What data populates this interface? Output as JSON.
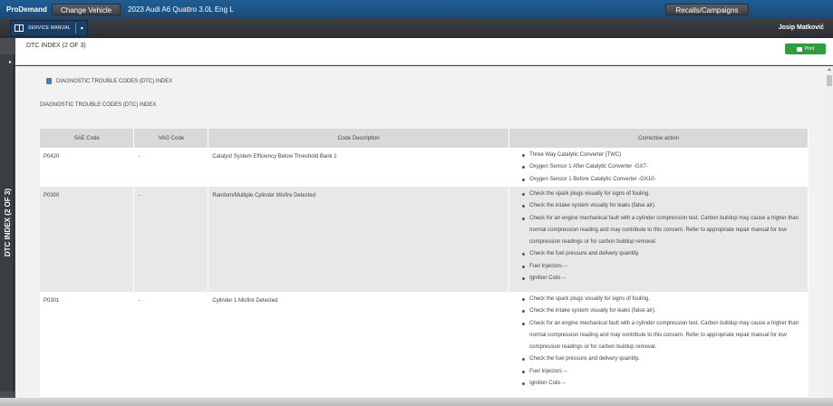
{
  "topbar": {
    "brand": "ProDemand",
    "change_vehicle": "Change Vehicle",
    "vehicle": "2023 Audi A6 Quattro 3.0L Eng L",
    "recalls": "Recalls/Campaigns"
  },
  "subbar": {
    "service_manual": "SERVICE MANUAL",
    "user": "Josip Matković"
  },
  "sidebar": {
    "label": "DTC INDEX (2 OF 3)"
  },
  "page": {
    "title": "DTC INDEX (2 OF 3)",
    "print": "Print",
    "breadcrumb": "DIAGNOSTIC TROUBLE CODES (DTC) INDEX",
    "heading": "DIAGNOSTIC TROUBLE CODES (DTC) INDEX"
  },
  "table": {
    "headers": [
      "SAE Code",
      "VAG Code",
      "Code Description",
      "Corrective action"
    ],
    "rows": [
      {
        "sae": "P0420",
        "vag": "-",
        "desc": "Catalyst System Efficiency Below Threshold Bank 1",
        "actions": [
          "Three Way Catalytic Converter (TWC)",
          "Oxygen Sensor 1 After Catalytic Converter -GX7-",
          "Oxygen Sensor 1 Before Catalytic Converter -GX10-"
        ]
      },
      {
        "sae": "P0300",
        "vag": "-",
        "desc": "Random/Multiple Cylinder Misfire Detected",
        "actions": [
          "Check the spark plugs visually for signs of fouling.",
          "Check the intake system visually for leaks (false air).",
          "Check for an engine mechanical fault with a cylinder compression test. Carbon buildup may cause a higher than normal compression reading and may contribute to this concern. Refer to appropriate repair manual for low compression readings or for carbon buildup removal.",
          "Check the fuel pressure and delivery quantity.",
          "Fuel Injectors --",
          "Ignition Coils --"
        ]
      },
      {
        "sae": "P0301",
        "vag": "-",
        "desc": "Cylinder 1 Misfire Detected",
        "actions": [
          "Check the spark plugs visually for signs of fouling.",
          "Check the intake system visually for leaks (false air).",
          "Check for an engine mechanical fault with a cylinder compression test. Carbon buildup may cause a higher than normal compression reading and may contribute to this concern. Refer to appropriate repair manual for low compression readings or for carbon buildup removal.",
          "Check the fuel pressure and delivery quantity.",
          "Fuel Injectors --",
          "Ignition Coils --"
        ]
      }
    ]
  },
  "colors": {
    "topbar": "#1f5d92",
    "print_button": "#2e9e3e",
    "table_header": "#d9d9d9"
  }
}
